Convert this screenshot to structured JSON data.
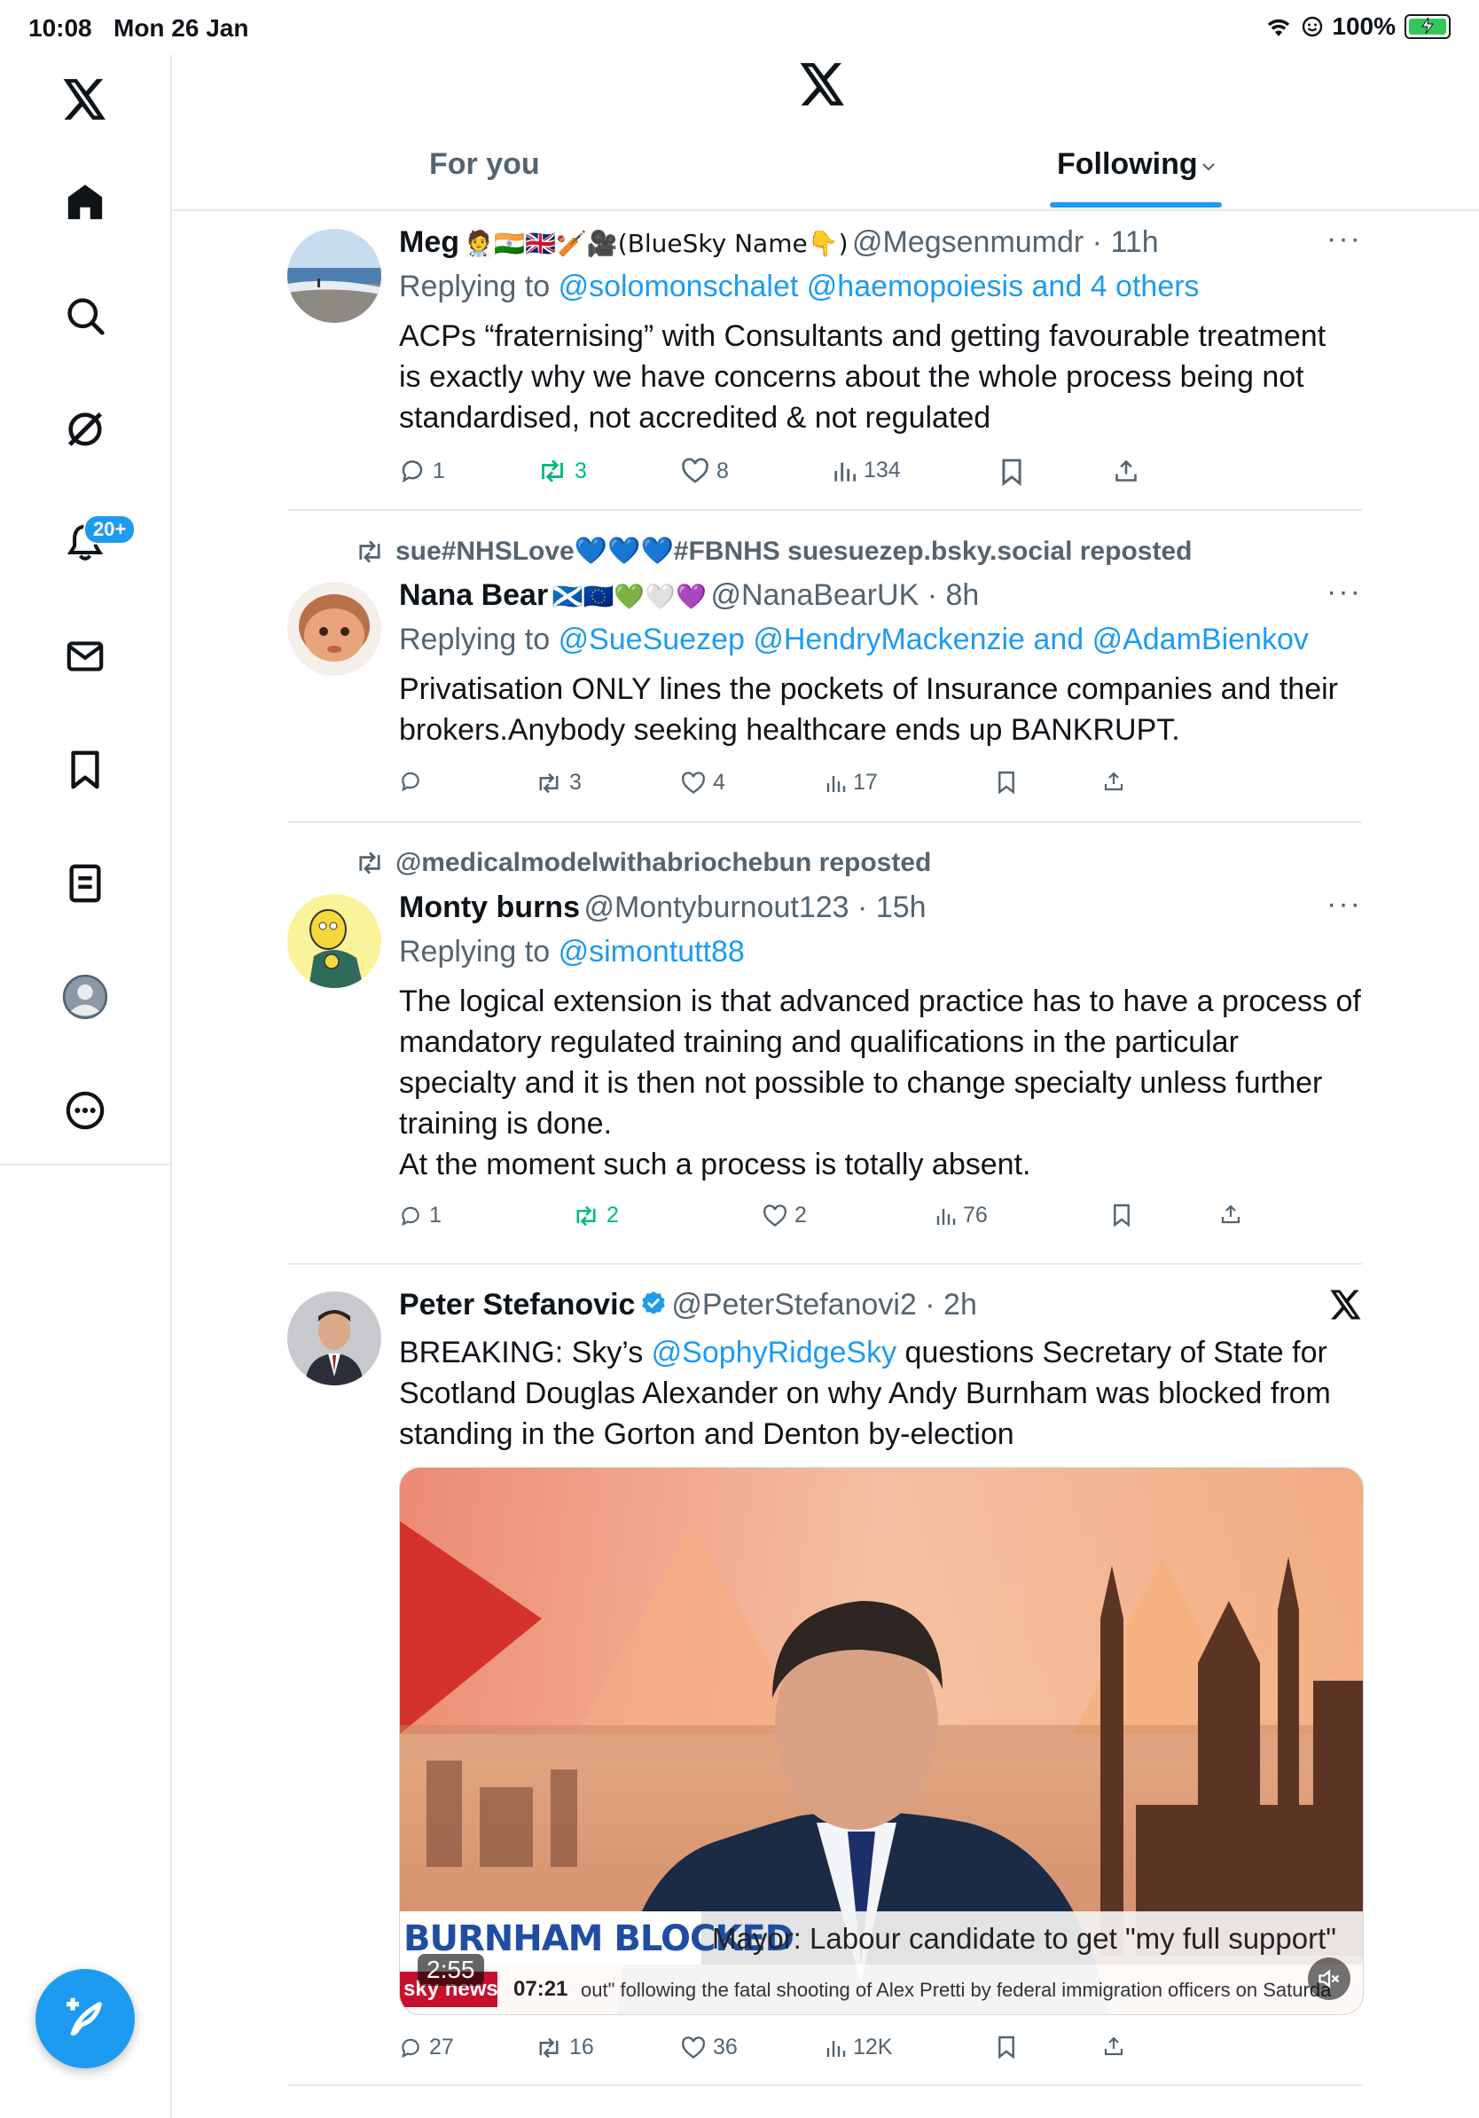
{
  "status_bar": {
    "time": "10:08",
    "date": "Mon 26 Jan",
    "battery": "100%"
  },
  "sidebar": {
    "notification_badge": "20+"
  },
  "header": {
    "tab_for_you": "For you",
    "tab_following": "Following"
  },
  "tweets": [
    {
      "name": "Meg",
      "emojis": "🧑‍⚕️🇮🇳🇬🇧🏏🎥(BlueSky Name👇)",
      "handle": "@Megsenmumdr",
      "time": "11h",
      "replying_prefix": "Replying to",
      "replying_to": "@solomonschalet @haemopoiesis and 4 others",
      "text": "ACPs “fraternising” with Consultants and getting favourable treatment is exactly why we have concerns about the whole process being not standardised, not accredited & not regulated",
      "replies": "1",
      "reposts": "3",
      "likes": "8",
      "views": "134"
    },
    {
      "reposted_by": "sue#NHSLove💙💙💙#FBNHS suesuezep.bsky.social reposted",
      "name": "Nana Bear",
      "emojis": "🏴󠁧󠁢󠁳󠁣󠁴󠁿🇪🇺💚🤍💜",
      "handle": "@NanaBearUK",
      "time": "8h",
      "replying_prefix": "Replying to",
      "replying_to": "@SueSuezep @HendryMackenzie and @AdamBienkov",
      "text": "Privatisation ONLY lines the pockets of Insurance companies and their brokers.Anybody seeking healthcare ends up BANKRUPT.",
      "replies": "",
      "reposts": "3",
      "likes": "4",
      "views": "17"
    },
    {
      "reposted_by": "@medicalmodelwithabriochebun reposted",
      "name": "Monty burns",
      "handle": "@Montyburnout123",
      "time": "15h",
      "replying_prefix": "Replying to",
      "replying_to": "@simontutt88",
      "text": "The logical extension is that advanced practice has to have a process of mandatory regulated training and qualifications in the particular specialty and it is then not possible to change specialty unless further training is done.\nAt the moment such a process is totally absent.",
      "replies": "1",
      "reposts": "2",
      "likes": "2",
      "views": "76"
    },
    {
      "name": "Peter Stefanovic",
      "handle": "@PeterStefanovi2",
      "time": "2h",
      "text_pre": "BREAKING: Sky’s ",
      "text_link": "@SophyRidgeSky",
      "text_post": " questions Secretary of State for Scotland Douglas Alexander on why Andy Burnham was blocked from standing in the Gorton and Denton by-election",
      "video": {
        "banner": "BURNHAM BLOCKED",
        "headline": "Mayor: Labour candidate to get \"my full support\"",
        "clock": "07:21",
        "ticker": "out\" following the fatal shooting of Alex Pretti by federal immigration officers on Saturda",
        "duration": "2:55",
        "logo": "sky news"
      },
      "replies": "27",
      "reposts": "16",
      "likes": "36",
      "views": "12K"
    }
  ]
}
